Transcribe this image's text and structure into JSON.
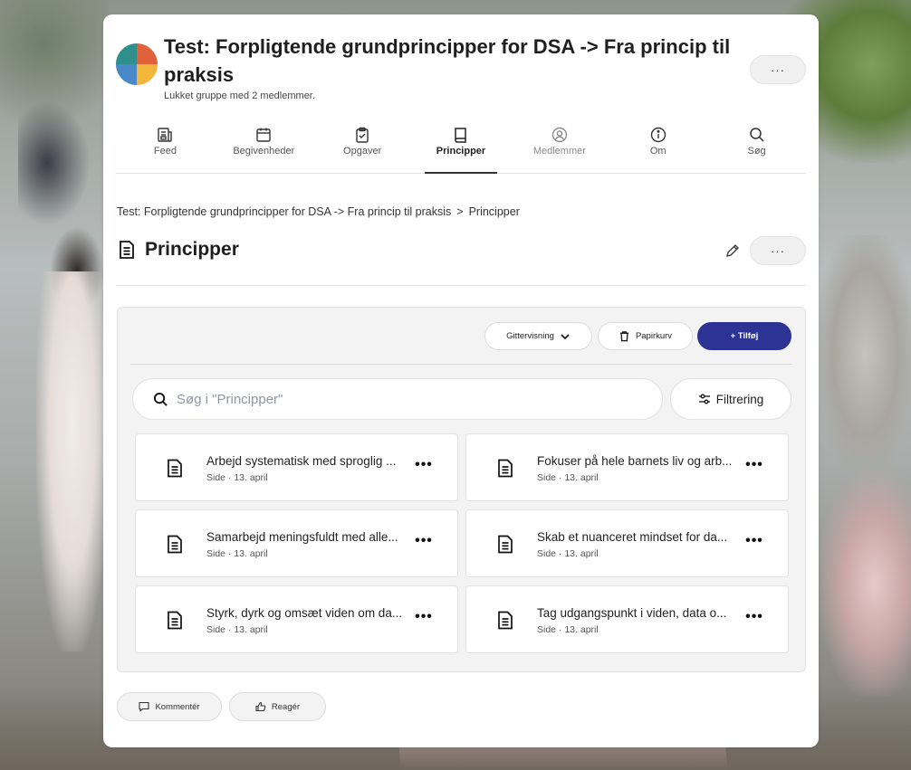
{
  "group": {
    "title": "Test: Forpligtende grundprincipper for DSA -> Fra princip til praksis",
    "subtitle": "Lukket gruppe med 2 medlemmer.",
    "more_label": "···"
  },
  "tabs": [
    {
      "label": "Feed",
      "icon": "feed-icon"
    },
    {
      "label": "Begivenheder",
      "icon": "calendar-icon"
    },
    {
      "label": "Opgaver",
      "icon": "clipboard-check-icon"
    },
    {
      "label": "Principper",
      "icon": "book-icon",
      "active": true
    },
    {
      "label": "Medlemmer",
      "icon": "user-circle-icon"
    },
    {
      "label": "Om",
      "icon": "info-icon"
    },
    {
      "label": "Søg",
      "icon": "search-icon"
    }
  ],
  "breadcrumb": {
    "parent": "Test: Forpligtende grundprincipper for DSA -> Fra princip til praksis",
    "separator": ">",
    "current": "Principper"
  },
  "page": {
    "title": "Principper",
    "more_label": "···"
  },
  "toolbar": {
    "view_label": "Gittervisning",
    "trash_label": "Papirkurv",
    "add_label": "+ Tilføj"
  },
  "search": {
    "placeholder": "Søg i \"Principper\"",
    "value": ""
  },
  "filter": {
    "label": "Filtrering"
  },
  "items": [
    {
      "name": "Arbejd systematisk med sproglig ...",
      "meta": "Side · 13. april"
    },
    {
      "name": "Fokuser på hele barnets liv og arb...",
      "meta": "Side · 13. april"
    },
    {
      "name": "Samarbejd meningsfuldt med alle...",
      "meta": "Side · 13. april"
    },
    {
      "name": "Skab et nuanceret mindset for da...",
      "meta": "Side · 13. april"
    },
    {
      "name": "Styrk, dyrk og omsæt viden om da...",
      "meta": "Side · 13. april"
    },
    {
      "name": "Tag udgangspunkt i viden, data o...",
      "meta": "Side · 13. april"
    }
  ],
  "item_more_label": "•••",
  "footer": {
    "comment_label": "Kommentér",
    "react_label": "Reagér"
  },
  "colors": {
    "primary": "#2c3394",
    "panel": "#f3f3f3"
  }
}
